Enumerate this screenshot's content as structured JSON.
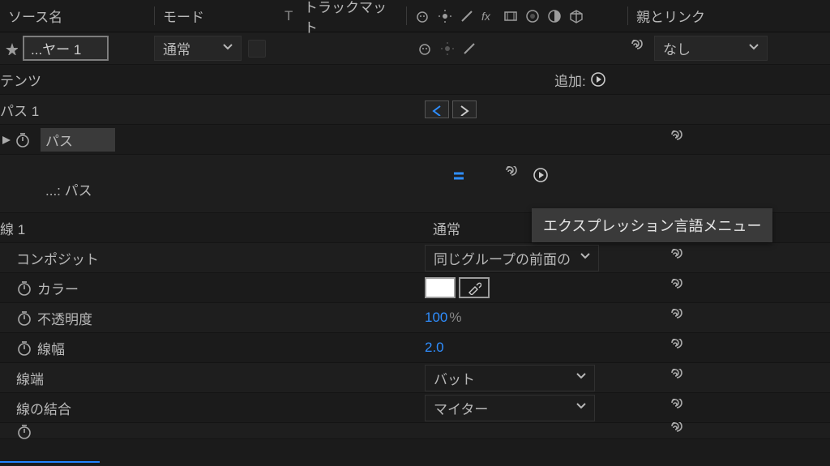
{
  "header": {
    "source_name": "ソース名",
    "mode": "モード",
    "t": "T",
    "track_matte": "トラックマット",
    "parent_link": "親とリンク"
  },
  "layer": {
    "name": "...ヤー 1",
    "mode_value": "通常",
    "parent_value": "なし"
  },
  "contents": {
    "label": "テンツ",
    "add_label": "追加:"
  },
  "path_group": {
    "label": "パス 1",
    "path_prop": "パス",
    "expr_label": "...: パス"
  },
  "stroke": {
    "label": "線 1",
    "mode_value": "通常",
    "composite_label": "コンポジット",
    "composite_value": "同じグループの前面の",
    "color_label": "カラー",
    "color_hex": "#ffffff",
    "opacity_label": "不透明度",
    "opacity_value": "100",
    "opacity_unit": "%",
    "width_label": "線幅",
    "width_value": "2.0",
    "cap_label": "線端",
    "cap_value": "バット",
    "join_label": "線の結合",
    "join_value": "マイター"
  },
  "tooltip": "エクスプレッション言語メニュー"
}
